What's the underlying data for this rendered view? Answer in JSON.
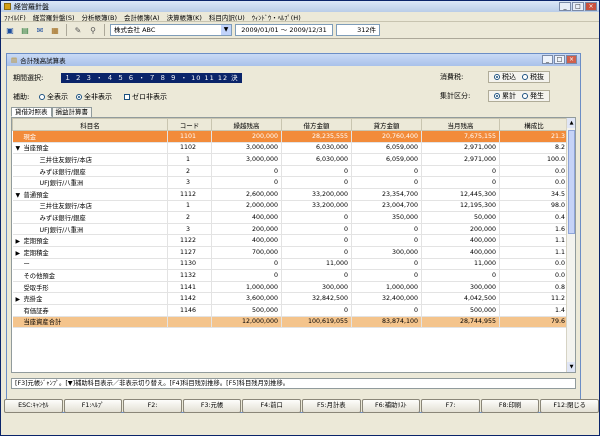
{
  "app": {
    "title": "経営羅針盤"
  },
  "menu": [
    "ﾌｧｲﾙ(F)",
    "経営羅針盤(S)",
    "分析帳簿(B)",
    "会計帳簿(A)",
    "決算帳簿(K)",
    "科目内訳(U)",
    "ｳｨﾝﾄﾞｳ・ﾍﾙﾌﾟ(H)"
  ],
  "toolbar": {
    "company": "株式会社 ABC",
    "period": "2009/01/01 ～ 2009/12/31",
    "count": "312件"
  },
  "child": {
    "title": "合計残高試算表"
  },
  "filters": {
    "kikan_label": "期間選択:",
    "kikan_value": "１ ２ ３ ・ ４ ５ ６ ・ ７ ８ ９ ・ 10 11 12 決",
    "hojo_label": "補助:",
    "hojo_opt1": "全表示",
    "hojo_opt2": "全非表示",
    "zero_label": "ゼロ非表示",
    "tax_label": "消費税:",
    "tax_opt1": "税込",
    "tax_opt2": "税抜",
    "agg_label": "集計区分:",
    "agg_opt1": "累計",
    "agg_opt2": "発生"
  },
  "tabs": [
    "貸借対照表",
    "損益計算書"
  ],
  "columns": [
    "科目名",
    "コード",
    "繰越残高",
    "借方金額",
    "貸方金額",
    "当月残高",
    "構成比"
  ],
  "rows": [
    {
      "name": "現金",
      "code": "1101",
      "a": "200,000",
      "b": "28,235,555",
      "c": "20,760,400",
      "d": "7,675,155",
      "r": "21.3",
      "style": "hl",
      "lvl": 0,
      "arrow": ""
    },
    {
      "name": "当座預金",
      "code": "1102",
      "a": "3,000,000",
      "b": "6,030,000",
      "c": "6,059,000",
      "d": "2,971,000",
      "r": "8.2",
      "style": "",
      "lvl": 0,
      "arrow": "▼"
    },
    {
      "name": "三井住友銀行/本店",
      "code": "1",
      "a": "3,000,000",
      "b": "6,030,000",
      "c": "6,059,000",
      "d": "2,971,000",
      "r": "100.0",
      "style": "",
      "lvl": 1,
      "arrow": ""
    },
    {
      "name": "みずほ銀行/銀座",
      "code": "2",
      "a": "0",
      "b": "0",
      "c": "0",
      "d": "0",
      "r": "0.0",
      "style": "",
      "lvl": 1,
      "arrow": ""
    },
    {
      "name": "UFJ銀行/八重洲",
      "code": "3",
      "a": "0",
      "b": "0",
      "c": "0",
      "d": "0",
      "r": "0.0",
      "style": "",
      "lvl": 1,
      "arrow": ""
    },
    {
      "name": "普通預金",
      "code": "1112",
      "a": "2,600,000",
      "b": "33,200,000",
      "c": "23,354,700",
      "d": "12,445,300",
      "r": "34.5",
      "style": "",
      "lvl": 0,
      "arrow": "▼"
    },
    {
      "name": "三井住友銀行/本店",
      "code": "1",
      "a": "2,000,000",
      "b": "33,200,000",
      "c": "23,004,700",
      "d": "12,195,300",
      "r": "98.0",
      "style": "",
      "lvl": 1,
      "arrow": ""
    },
    {
      "name": "みずほ銀行/銀座",
      "code": "2",
      "a": "400,000",
      "b": "0",
      "c": "350,000",
      "d": "50,000",
      "r": "0.4",
      "style": "",
      "lvl": 1,
      "arrow": ""
    },
    {
      "name": "UFJ銀行/八重洲",
      "code": "3",
      "a": "200,000",
      "b": "0",
      "c": "0",
      "d": "200,000",
      "r": "1.6",
      "style": "",
      "lvl": 1,
      "arrow": ""
    },
    {
      "name": "定期預金",
      "code": "1122",
      "a": "400,000",
      "b": "0",
      "c": "0",
      "d": "400,000",
      "r": "1.1",
      "style": "",
      "lvl": 0,
      "arrow": "▶"
    },
    {
      "name": "定期積金",
      "code": "1127",
      "a": "700,000",
      "b": "0",
      "c": "300,000",
      "d": "400,000",
      "r": "1.1",
      "style": "",
      "lvl": 0,
      "arrow": "▶"
    },
    {
      "name": "ー",
      "code": "1130",
      "a": "0",
      "b": "11,000",
      "c": "0",
      "d": "11,000",
      "r": "0.0",
      "style": "",
      "lvl": 0,
      "arrow": ""
    },
    {
      "name": "その他預金",
      "code": "1132",
      "a": "0",
      "b": "0",
      "c": "0",
      "d": "0",
      "r": "0.0",
      "style": "",
      "lvl": 0,
      "arrow": ""
    },
    {
      "name": "受取手形",
      "code": "1141",
      "a": "1,000,000",
      "b": "300,000",
      "c": "1,000,000",
      "d": "300,000",
      "r": "0.8",
      "style": "",
      "lvl": 0,
      "arrow": ""
    },
    {
      "name": "売掛金",
      "code": "1142",
      "a": "3,600,000",
      "b": "32,842,500",
      "c": "32,400,000",
      "d": "4,042,500",
      "r": "11.2",
      "style": "",
      "lvl": 0,
      "arrow": "▶"
    },
    {
      "name": "有価証券",
      "code": "1146",
      "a": "500,000",
      "b": "0",
      "c": "0",
      "d": "500,000",
      "r": "1.4",
      "style": "",
      "lvl": 0,
      "arrow": ""
    },
    {
      "name": "当座資産合計",
      "code": "",
      "a": "12,000,000",
      "b": "100,619,055",
      "c": "83,874,100",
      "d": "28,744,955",
      "r": "79.6",
      "style": "total",
      "lvl": 0,
      "arrow": ""
    }
  ],
  "status_text": "[F3]元帳ｼﾞｬﾝﾌﾟ。[▼]補助科目表示／非表示切り替え。[F4]科目残別推移。[F5]科目残月別推移。",
  "fkeys": [
    "ESC:ｷｬﾝｾﾙ",
    "F1:ﾍﾙﾌﾟ",
    "F2:",
    "F3:元帳",
    "F4:前口",
    "F5:月計表",
    "F6:補助ﾘｽﾄ",
    "F7:",
    "F8:印刷",
    "F12:閉じる"
  ]
}
